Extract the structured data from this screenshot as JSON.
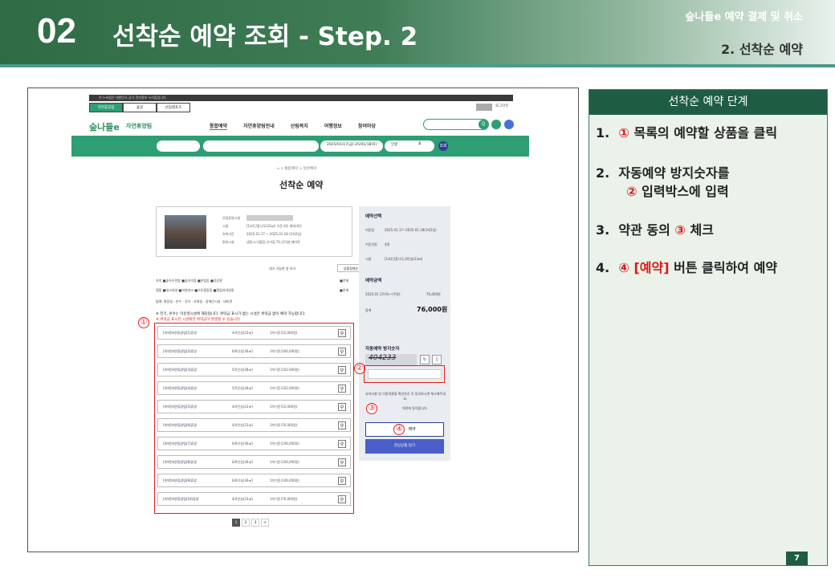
{
  "header": {
    "number": "02",
    "title": "선착순 예약 조회 - Step. 2",
    "subtitle_top": "숲나들e 예약 결제 및 취소",
    "subtitle_bottom": "2. 선착순 예약"
  },
  "screenshot": {
    "topbar_text": "이 누리집은 대한민국 공식 전자정부 누리집입니다.",
    "tabs": [
      "자연휴양림",
      "숲길",
      "산림레포츠"
    ],
    "login": "로그아웃",
    "logo": "숲나들e",
    "site_name": "자연휴양림",
    "menu": [
      "통합예약",
      "자연휴양림안내",
      "산림복지",
      "여행정보",
      "참여마당"
    ],
    "search_btn": "Q",
    "date_range": "2025/01/17(금)-25/01/18(토)",
    "people_label": "인원",
    "people_count": "2",
    "query_btn": "조회",
    "breadcrumb": "⌂ > 통합예약 > 일반예약",
    "page_heading": "선착순 예약",
    "card": {
      "lines": [
        "산림휴양시설",
        "시설",
        "숙박기간",
        "편의시설"
      ],
      "values": [
        "",
        "[1호]단풍나무(23㎡) 기준:4인 최대:6인",
        "2025.01.17 ~ 2025.01.18 (1박2일)",
        "냉장고,이불장,식기류,TV,인덕션,에어컨"
      ]
    },
    "available_only": "대기 가능한 방 보기",
    "sort": "상품정렬순",
    "filters": {
      "row1_label": "숙박",
      "row1": "■숲속수련장 ■숲속의집 ■연립동 ■휴양관",
      "row1_all": "■전체",
      "row2_label": "캠핑",
      "row2": "■데크야영 ■야영데크 ■오토캠핑장 ■캠핑카야영장",
      "row2_all": "■전체",
      "legend": "범례: 화장실 · 온수 · 전기 · 샤워실 · 장애인시설 · 바비큐"
    },
    "notes": [
      "※ 전기, 온수는 미운영시설에 해당됩니다. 위약금 표시가 없는 시설은 위약금 없이 예약 가능합니다.",
      "※ 위약금 표시된 시설에만 위약금이 발생할 수 있습니다."
    ],
    "rows": [
      {
        "name": "[숙박]자연휴양림(1)휴양",
        "size": "4/4인실(23㎡)",
        "price": "1박기준(52,000원)"
      },
      {
        "name": "[숙박]자연휴양림(2)휴양",
        "size": "6/6인실(36㎡)",
        "price": "1박기준(106,000원)"
      },
      {
        "name": "[숙박]자연휴양림(3)휴양",
        "size": "5/5인실(28㎡)",
        "price": "1박기준(102,000원)"
      },
      {
        "name": "[숙박]자연휴양림(4)휴양",
        "size": "5/5인실(28㎡)",
        "price": "1박기준(102,000원)"
      },
      {
        "name": "[숙박]자연휴양림(5)휴양",
        "size": "4/4인실(23㎡)",
        "price": "1박기준(52,000원)"
      },
      {
        "name": "[숙박]자연휴양림(6)휴양",
        "size": "4/4인실(23㎡)",
        "price": "1박기준(76,000원)"
      },
      {
        "name": "[숙박]자연휴양림(7)휴양",
        "size": "6/6인실(36㎡)",
        "price": "1박기준(106,000원)"
      },
      {
        "name": "[숙박]자연휴양림(8)휴양",
        "size": "6/6인실(36㎡)",
        "price": "1박기준(106,000원)"
      },
      {
        "name": "[숙박]자연휴양림(9)휴양",
        "size": "6/6인실(36㎡)",
        "price": "1박기준(106,000원)"
      },
      {
        "name": "[숙박]자연휴양림(10)휴양",
        "size": "4/4인실(23㎡)",
        "price": "1박기준(76,000원)"
      }
    ],
    "pager": [
      "1",
      "2",
      "3",
      ">"
    ],
    "side": {
      "select_title": "예약선택",
      "date_label": "이용일",
      "date_value": "2025.01.17~2025.01.18(1박2일)",
      "count_label": "기준인원",
      "count_value": "4명",
      "facility_label": "시설",
      "facility_value": "[1호]단풍나무,4인실(23㎡)",
      "amount_title": "예약금액",
      "amount_line": "2025.01.17(목)~(주말)",
      "amount_line_value": "76,000원",
      "total_label": "합계",
      "total_value": "76,000원",
      "captcha_title": "자동예약 방지숫자",
      "captcha_value": "404233",
      "agree_text": "유의사항 및 이용약관을 확인하신 후 동의하시면 체크해주세요.",
      "agree_check": "약관에 동의합니다.",
      "reserve": "예약",
      "wishlist": "관심상품 담기"
    },
    "markers": [
      "①",
      "②",
      "③",
      "④"
    ]
  },
  "panel": {
    "title": "선착순 예약 단계",
    "steps": [
      {
        "no": "1.",
        "mark": "①",
        "text": "목록의 예약할 상품을 클릭"
      },
      {
        "no": "2.",
        "line1": "자동예약 방지숫자를",
        "mark": "②",
        "text": "입력박스에 입력"
      },
      {
        "no": "3.",
        "pre": "약관 동의",
        "mark": "③",
        "text": "체크"
      },
      {
        "no": "4.",
        "mark": "④",
        "red": "[예약]",
        "text": "버튼 클릭하여 예약"
      }
    ]
  },
  "page_number": "7"
}
